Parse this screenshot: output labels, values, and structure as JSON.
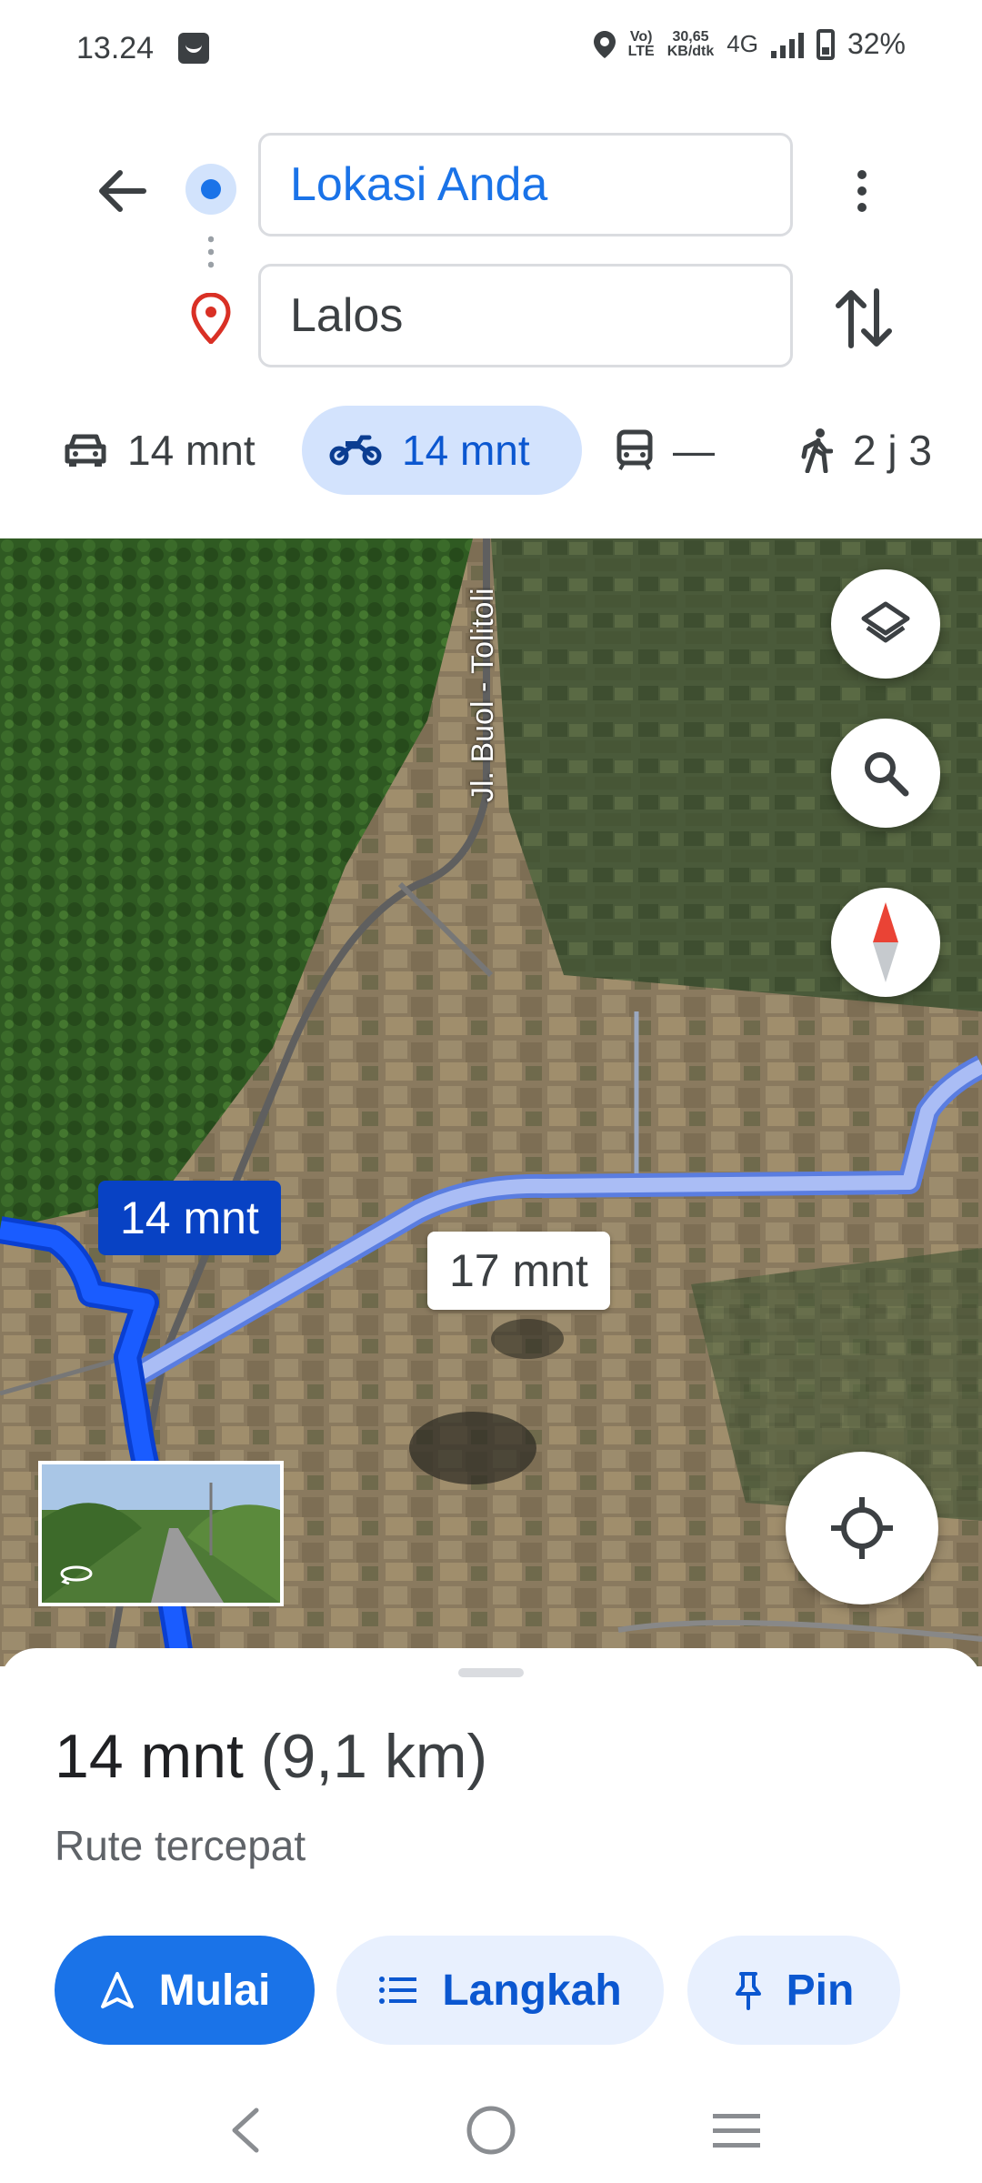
{
  "status_bar": {
    "time": "13.24",
    "volte_top": "Vo)",
    "volte_bottom": "LTE",
    "speed_top": "30,65",
    "speed_bottom": "KB/dtk",
    "network": "4G",
    "battery": "32%"
  },
  "directions": {
    "origin": "Lokasi Anda",
    "destination": "Lalos"
  },
  "modes": [
    {
      "icon": "car-icon",
      "label": "14 mnt",
      "active": false
    },
    {
      "icon": "motorcycle-icon",
      "label": "14 mnt",
      "active": true
    },
    {
      "icon": "transit-icon",
      "label": "—",
      "active": false
    },
    {
      "icon": "walk-icon",
      "label": "2 j 3",
      "active": false
    }
  ],
  "map": {
    "road_name": "Jl. Buol - Tolitoli",
    "route_time_main": "14 mnt",
    "route_time_alt": "17 mnt",
    "route_color": "#1a5cff",
    "alt_route_color": "#aabdf5"
  },
  "sheet": {
    "duration": "14 mnt",
    "distance": "(9,1 km)",
    "subtitle": "Rute tercepat",
    "start_label": "Mulai",
    "steps_label": "Langkah",
    "pin_label": "Pin"
  }
}
